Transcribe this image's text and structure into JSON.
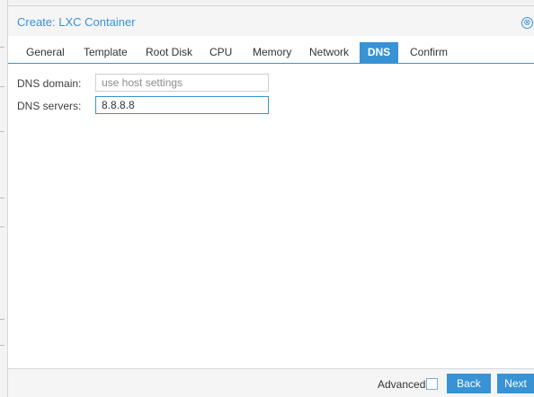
{
  "dialog": {
    "title": "Create: LXC Container",
    "close_glyph": "⊗"
  },
  "tabs": [
    {
      "label": "General"
    },
    {
      "label": "Template"
    },
    {
      "label": "Root Disk"
    },
    {
      "label": "CPU"
    },
    {
      "label": "Memory"
    },
    {
      "label": "Network"
    },
    {
      "label": "DNS",
      "active": true
    },
    {
      "label": "Confirm"
    }
  ],
  "form": {
    "dns_domain": {
      "label": "DNS domain:",
      "value": "",
      "placeholder": "use host settings"
    },
    "dns_servers": {
      "label": "DNS servers:",
      "value": "8.8.8.8",
      "placeholder": ""
    }
  },
  "footer": {
    "advanced_label": "Advanced",
    "advanced_checked": false,
    "back_label": "Back",
    "next_label": "Next"
  },
  "colors": {
    "accent": "#3892d4",
    "panel_bg": "#f5f5f5"
  }
}
